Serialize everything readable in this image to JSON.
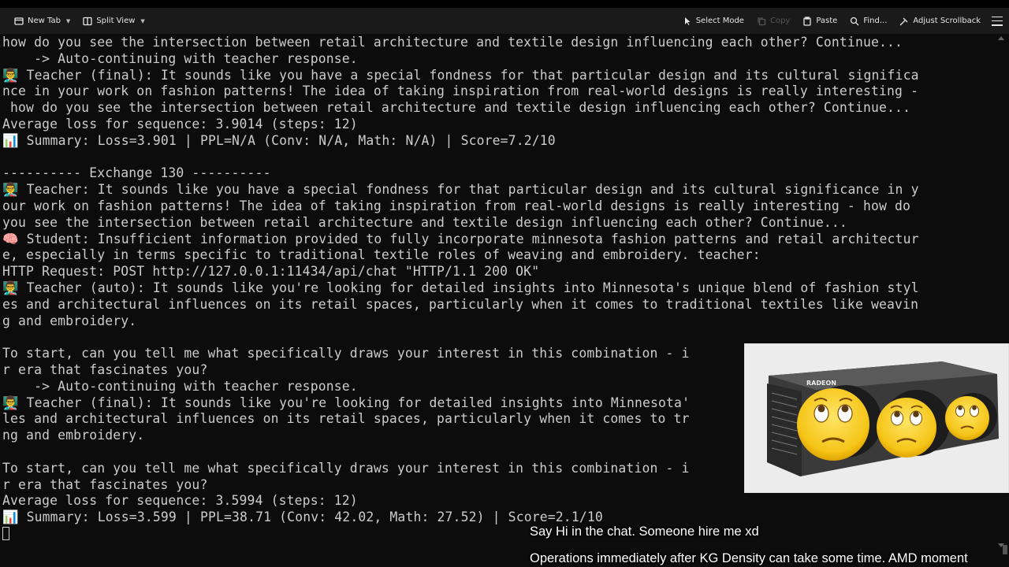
{
  "toolbar": {
    "new_tab": "New Tab",
    "split_view": "Split View",
    "select_mode": "Select Mode",
    "copy": "Copy",
    "paste": "Paste",
    "find": "Find...",
    "adjust_scrollback": "Adjust Scrollback"
  },
  "terminal": {
    "lines": [
      "how do you see the intersection between retail architecture and textile design influencing each other? Continue...",
      "    -> Auto-continuing with teacher response.",
      "👨‍🏫 Teacher (final): It sounds like you have a special fondness for that particular design and its cultural significa",
      "nce in your work on fashion patterns! The idea of taking inspiration from real-world designs is really interesting -",
      " how do you see the intersection between retail architecture and textile design influencing each other? Continue...",
      "Average loss for sequence: 3.9014 (steps: 12)",
      "📊 Summary: Loss=3.901 | PPL=N/A (Conv: N/A, Math: N/A) | Score=7.2/10",
      "",
      "---------- Exchange 130 ----------",
      "👨‍🏫 Teacher: It sounds like you have a special fondness for that particular design and its cultural significance in y",
      "our work on fashion patterns! The idea of taking inspiration from real-world designs is really interesting - how do",
      "you see the intersection between retail architecture and textile design influencing each other? Continue...",
      "🧠 Student: Insufficient information provided to fully incorporate minnesota fashion patterns and retail architectur",
      "e, especially in terms specific to traditional textile roles of weaving and embroidery. teacher:",
      "HTTP Request: POST http://127.0.0.1:11434/api/chat \"HTTP/1.1 200 OK\"",
      "👨‍🏫 Teacher (auto): It sounds like you're looking for detailed insights into Minnesota's unique blend of fashion styl",
      "es and architectural influences on its retail spaces, particularly when it comes to traditional textiles like weavin",
      "g and embroidery.",
      "",
      "To start, can you tell me what specifically draws your interest in this combination - i",
      "r era that fascinates you?",
      "    -> Auto-continuing with teacher response.",
      "👨‍🏫 Teacher (final): It sounds like you're looking for detailed insights into Minnesota'",
      "les and architectural influences on its retail spaces, particularly when it comes to tr",
      "ng and embroidery.",
      "",
      "To start, can you tell me what specifically draws your interest in this combination - i",
      "r era that fascinates you?",
      "Average loss for sequence: 3.5994 (steps: 12)",
      "📊 Summary: Loss=3.599 | PPL=38.71 (Conv: 42.02, Math: 27.52) | Score=2.1/10"
    ]
  },
  "overlay": {
    "caption_top": "Say Hi in the chat. Someone hire me xd",
    "caption_bottom": "Operations immediately after KG Density can take some time. AMD moment",
    "gpu_brand": "RADEON"
  },
  "colors": {
    "background": "#0c0c0c",
    "text": "#cccccc",
    "toolbar": "#1a1a1a"
  }
}
